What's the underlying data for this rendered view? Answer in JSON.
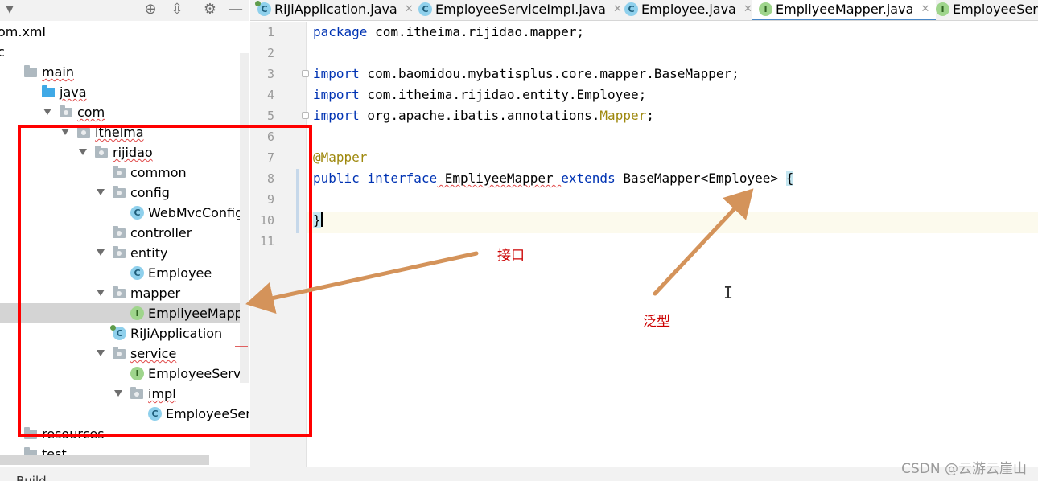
{
  "project_tree": [
    {
      "label": "om.xml",
      "icon": "none",
      "indent": 0,
      "caret": false,
      "squiggle": false
    },
    {
      "label": "c",
      "icon": "none",
      "indent": 0,
      "caret": false,
      "squiggle": false
    },
    {
      "label": "main",
      "icon": "folder",
      "indent": 0,
      "caret": false,
      "squiggle": true
    },
    {
      "label": "java",
      "icon": "source-folder",
      "indent": 1,
      "caret": false,
      "squiggle": true
    },
    {
      "label": "com",
      "icon": "package",
      "indent": 2,
      "caret": true,
      "squiggle": true
    },
    {
      "label": "itheima",
      "icon": "package",
      "indent": 3,
      "caret": true,
      "squiggle": true
    },
    {
      "label": "rijidao",
      "icon": "package",
      "indent": 4,
      "caret": true,
      "squiggle": true
    },
    {
      "label": "common",
      "icon": "package",
      "indent": 5,
      "caret": false,
      "squiggle": false
    },
    {
      "label": "config",
      "icon": "package",
      "indent": 5,
      "caret": true,
      "squiggle": false
    },
    {
      "label": "WebMvcConfig",
      "icon": "class",
      "indent": 6,
      "caret": false,
      "squiggle": false
    },
    {
      "label": "controller",
      "icon": "package",
      "indent": 5,
      "caret": false,
      "squiggle": false
    },
    {
      "label": "entity",
      "icon": "package",
      "indent": 5,
      "caret": true,
      "squiggle": false
    },
    {
      "label": "Employee",
      "icon": "class",
      "indent": 6,
      "caret": false,
      "squiggle": false
    },
    {
      "label": "mapper",
      "icon": "package",
      "indent": 5,
      "caret": true,
      "squiggle": false
    },
    {
      "label": "EmpliyeeMapper",
      "icon": "interface",
      "indent": 6,
      "caret": false,
      "squiggle": false,
      "selected": true
    },
    {
      "label": "RiJiApplication",
      "icon": "app-class",
      "indent": 5,
      "caret": false,
      "squiggle": false
    },
    {
      "label": "service",
      "icon": "package",
      "indent": 5,
      "caret": true,
      "squiggle": true
    },
    {
      "label": "EmployeeService",
      "icon": "interface",
      "indent": 6,
      "caret": false,
      "squiggle": false
    },
    {
      "label": "impl",
      "icon": "package",
      "indent": 6,
      "caret": true,
      "squiggle": true
    },
    {
      "label": "EmployeeServiceIm",
      "icon": "class",
      "indent": 7,
      "caret": false,
      "squiggle": false
    },
    {
      "label": "resources",
      "icon": "folder",
      "indent": 0,
      "caret": false,
      "squiggle": false
    },
    {
      "label": "test",
      "icon": "folder",
      "indent": 0,
      "caret": false,
      "squiggle": false
    }
  ],
  "tabs": [
    {
      "label": "RiJiApplication.java",
      "icon": "app-class",
      "active": false
    },
    {
      "label": "EmployeeServiceImpl.java",
      "icon": "class",
      "active": false
    },
    {
      "label": "Employee.java",
      "icon": "class",
      "active": false
    },
    {
      "label": "EmpliyeeMapper.java",
      "icon": "interface",
      "active": true
    },
    {
      "label": "EmployeeServ",
      "icon": "interface",
      "active": false
    }
  ],
  "editor": {
    "line_numbers": [
      "1",
      "2",
      "3",
      "4",
      "5",
      "6",
      "7",
      "8",
      "9",
      "10",
      "11"
    ],
    "current_line": 10,
    "code_lines": [
      [
        {
          "t": "package",
          "c": "kw"
        },
        {
          "t": " com.itheima.rijidao.mapper;",
          "c": ""
        }
      ],
      [],
      [
        {
          "t": "import",
          "c": "kw"
        },
        {
          "t": " com.baomidou.mybatisplus.core.mapper.BaseMapper;",
          "c": ""
        }
      ],
      [
        {
          "t": "import",
          "c": "kw"
        },
        {
          "t": " com.itheima.rijidao.entity.Employee;",
          "c": ""
        }
      ],
      [
        {
          "t": "import",
          "c": "kw"
        },
        {
          "t": " org.apache.ibatis.annotations.",
          "c": ""
        },
        {
          "t": "Mapper",
          "c": "ann"
        },
        {
          "t": ";",
          "c": ""
        }
      ],
      [],
      [
        {
          "t": "@Mapper",
          "c": "ann"
        }
      ],
      [
        {
          "t": "public",
          "c": "kw"
        },
        {
          "t": " ",
          "c": ""
        },
        {
          "t": "interface",
          "c": "kw"
        },
        {
          "t": " EmpliyeeMapper ",
          "c": "squiggle"
        },
        {
          "t": "extends",
          "c": "kw"
        },
        {
          "t": " BaseMapper<Employee> ",
          "c": ""
        },
        {
          "t": "{",
          "c": "brace-hl"
        }
      ],
      [],
      [
        {
          "t": "}",
          "c": "brace-hl"
        }
      ],
      []
    ]
  },
  "bottom": {
    "build_label": "Build"
  },
  "watermark": "CSDN @云游云崖山",
  "annotations": {
    "interface_note": "接口",
    "generic_note": "泛型"
  },
  "colors": {
    "highlight_frame": "#ff0000",
    "arrow": "#d4935a",
    "note_text": "#cc0000",
    "keyword": "#0033b3",
    "annotation": "#9e880d",
    "active_tab_underline": "#4a88c7"
  },
  "toolbar_icons": [
    "chevron-down-icon",
    "crosshair-icon",
    "collapse-icon",
    "gear-icon",
    "minimize-icon"
  ]
}
